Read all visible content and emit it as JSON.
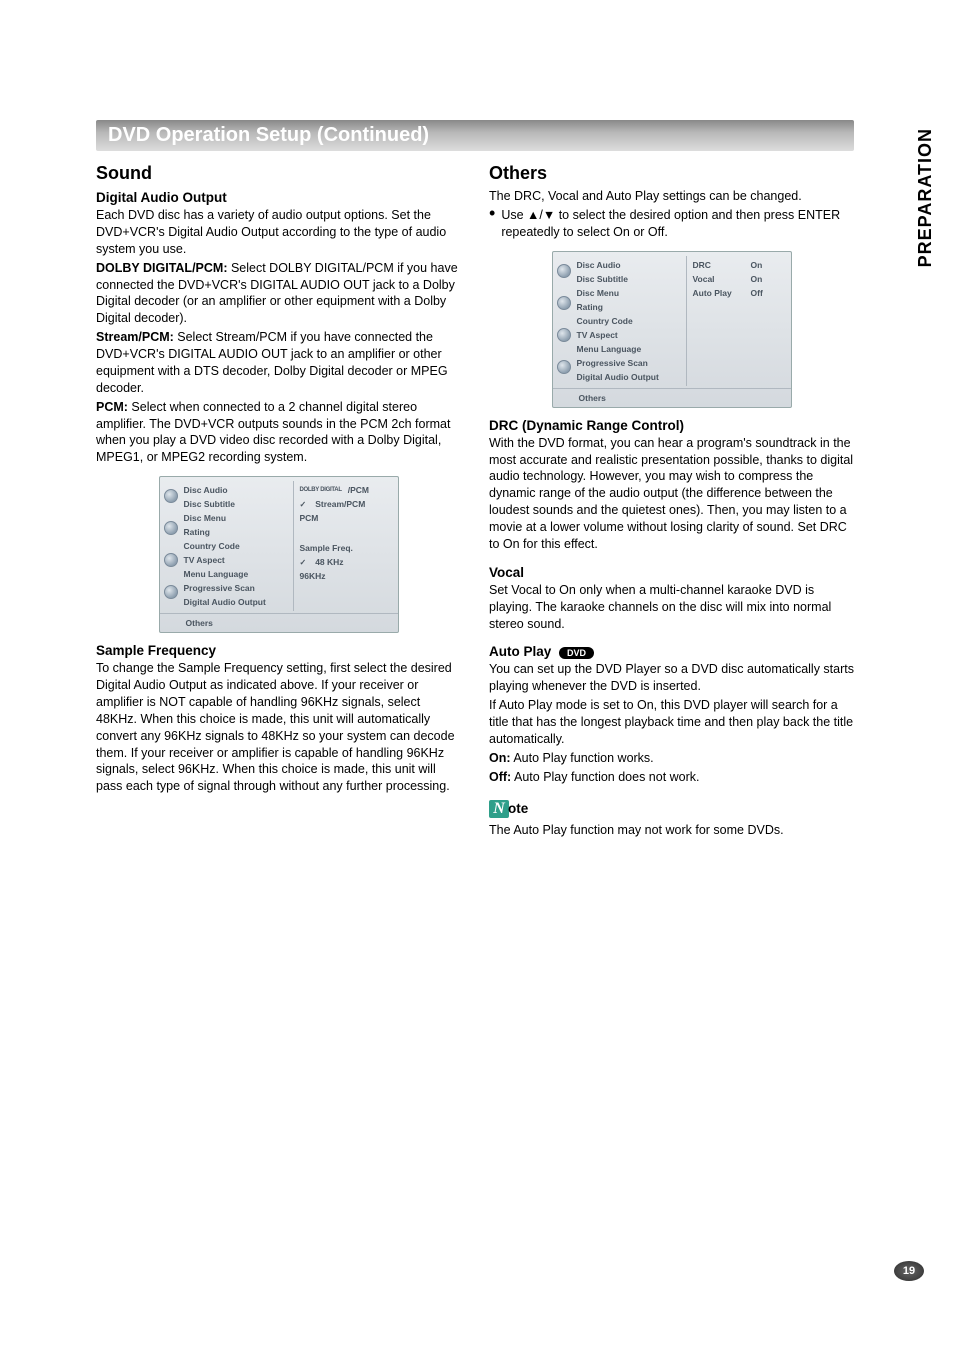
{
  "sideTab": "PREPARATION",
  "pageNumber": "19",
  "titleBar": "DVD Operation Setup (Continued)",
  "left": {
    "h2": "Sound",
    "h3a": "Digital Audio Output",
    "p1": "Each DVD disc has a variety of audio output options. Set the DVD+VCR's Digital Audio Output according to the type of audio system you use.",
    "dolbyLabel": "DOLBY DIGITAL/PCM:",
    "dolbyText": " Select DOLBY DIGITAL/PCM if you have connected the DVD+VCR's DIGITAL AUDIO OUT jack to a Dolby Digital decoder (or an amplifier or other equipment with a Dolby Digital decoder).",
    "streamLabel": "Stream/PCM:",
    "streamText": " Select Stream/PCM if you have connected the DVD+VCR's DIGITAL AUDIO OUT jack to an amplifier or other equipment with a DTS decoder, Dolby Digital decoder or MPEG decoder.",
    "pcmLabel": "PCM:",
    "pcmText": " Select when connected to a 2 channel digital stereo amplifier. The DVD+VCR outputs sounds in the PCM 2ch format when you play a DVD video disc recorded with a Dolby Digital, MPEG1, or MPEG2 recording system.",
    "h3b": "Sample Frequency",
    "p2": "To change the Sample Frequency setting, first select the desired Digital Audio Output as indicated above. If your receiver or amplifier is NOT capable of handling 96KHz signals, select 48KHz. When this choice is made, this unit will automatically convert any 96KHz signals to 48KHz so your system can decode them. If your receiver or amplifier is capable of handling 96KHz signals, select 96KHz. When this choice is made, this unit will pass each type of signal through without any further processing."
  },
  "right": {
    "h2": "Others",
    "p1": "The DRC, Vocal and Auto Play settings can be changed.",
    "bullet": "Use ▲/▼ to select the desired option and then press ENTER repeatedly to select On or Off.",
    "drcH": "DRC (Dynamic Range Control)",
    "drcP": "With the DVD format, you can hear a program's soundtrack in the most accurate and realistic presentation possible, thanks to digital audio technology. However, you may wish to compress the dynamic range of the audio output (the difference between the loudest sounds and the quietest ones). Then, you may listen to a movie at a lower volume without losing clarity of sound. Set DRC to On for this effect.",
    "vocalH": "Vocal",
    "vocalP": "Set Vocal to On only when a multi-channel karaoke DVD is playing. The karaoke channels on the disc will mix into normal stereo sound.",
    "autoH": "Auto Play",
    "dvdBadge": "DVD",
    "autoP1": "You can set up the DVD Player so a DVD disc automatically starts playing whenever the DVD is inserted.",
    "autoP2": "If Auto Play mode is set to On, this DVD player will search for a title that has the longest playback time and then play back the title automatically.",
    "onLabel": "On:",
    "onText": " Auto Play function works.",
    "offLabel": "Off:",
    "offText": " Auto Play function does not work.",
    "noteWord": "ote",
    "noteText": "The Auto Play function may not work for some DVDs."
  },
  "menuLeft": {
    "leftItems": [
      "Disc Audio",
      "Disc Subtitle",
      "Disc Menu",
      "Rating",
      "Country Code",
      "TV Aspect",
      "Menu Language",
      "Progressive Scan",
      "Digital Audio Output"
    ],
    "footer": "Others",
    "rightHeader1": "/PCM",
    "dolbyMini": "DOLBY DIGITAL",
    "rightRow2": "Stream/PCM",
    "rightRow3": "PCM",
    "sampleHeader": "Sample Freq.",
    "sample1": "48 KHz",
    "sample2": "96KHz"
  },
  "menuRight": {
    "leftItems": [
      "Disc Audio",
      "Disc Subtitle",
      "Disc Menu",
      "Rating",
      "Country Code",
      "TV Aspect",
      "Menu Language",
      "Progressive Scan",
      "Digital Audio Output"
    ],
    "footer": "Others",
    "r1l": "DRC",
    "r1v": "On",
    "r2l": "Vocal",
    "r2v": "On",
    "r3l": "Auto Play",
    "r3v": "Off"
  }
}
